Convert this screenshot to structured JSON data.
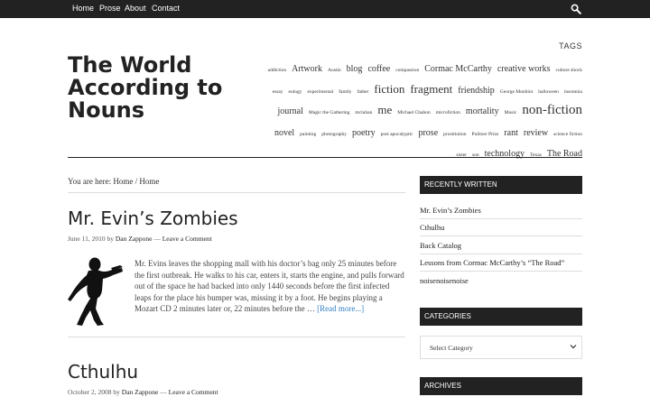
{
  "nav": {
    "items": [
      "Home",
      "Prose",
      "About",
      "Contact"
    ],
    "search_icon": "magnifier-icon"
  },
  "site": {
    "title": "The World According to Nouns"
  },
  "tags": {
    "heading": "TAGS",
    "cloud": [
      {
        "label": "addiction",
        "weight": 1
      },
      {
        "label": "Artwork",
        "weight": 3
      },
      {
        "label": "Austin",
        "weight": 1
      },
      {
        "label": "blog",
        "weight": 3
      },
      {
        "label": "coffee",
        "weight": 3
      },
      {
        "label": "compassion",
        "weight": 1
      },
      {
        "label": "Cormac McCarthy",
        "weight": 3
      },
      {
        "label": "creative works",
        "weight": 3
      },
      {
        "label": "culture shock",
        "weight": 1
      },
      {
        "label": "essay",
        "weight": 1
      },
      {
        "label": "eulogy",
        "weight": 1
      },
      {
        "label": "experimental",
        "weight": 1
      },
      {
        "label": "family",
        "weight": 1
      },
      {
        "label": "father",
        "weight": 1
      },
      {
        "label": "fiction",
        "weight": 4
      },
      {
        "label": "fragment",
        "weight": 4
      },
      {
        "label": "friendship",
        "weight": 3
      },
      {
        "label": "George Monbiot",
        "weight": 1
      },
      {
        "label": "halloween",
        "weight": 1
      },
      {
        "label": "insomnia",
        "weight": 1
      },
      {
        "label": "journal",
        "weight": 3
      },
      {
        "label": "Magic the Gathering",
        "weight": 1
      },
      {
        "label": "mcluhan",
        "weight": 1
      },
      {
        "label": "me",
        "weight": 4
      },
      {
        "label": "Michael Chabon",
        "weight": 1
      },
      {
        "label": "microfiction",
        "weight": 1
      },
      {
        "label": "mortality",
        "weight": 3
      },
      {
        "label": "Music",
        "weight": 1
      },
      {
        "label": "non-fiction",
        "weight": 5
      },
      {
        "label": "novel",
        "weight": 3
      },
      {
        "label": "painting",
        "weight": 1
      },
      {
        "label": "photography",
        "weight": 1
      },
      {
        "label": "poetry",
        "weight": 3
      },
      {
        "label": "post apocalyptic",
        "weight": 1
      },
      {
        "label": "prose",
        "weight": 3
      },
      {
        "label": "prostitution",
        "weight": 1
      },
      {
        "label": "Pulitzer Prize",
        "weight": 1
      },
      {
        "label": "rant",
        "weight": 3
      },
      {
        "label": "review",
        "weight": 3
      },
      {
        "label": "science fiction",
        "weight": 1
      },
      {
        "label": "sister",
        "weight": 1
      },
      {
        "label": "son",
        "weight": 1
      },
      {
        "label": "technology",
        "weight": 3
      },
      {
        "label": "Texas",
        "weight": 1
      },
      {
        "label": "The Road",
        "weight": 3
      }
    ]
  },
  "breadcrumb": {
    "prefix": "You are here:",
    "home": "Home",
    "separator": "/",
    "current": "Home"
  },
  "posts": [
    {
      "title": "Mr. Evin’s Zombies",
      "date": "June 11, 2010",
      "by": "by",
      "author": "Dan Zappone",
      "dash": "—",
      "comment_link": "Leave a Comment",
      "excerpt": "Mr. Evins leaves the shopping mall with his doctor’s bag only 25 minutes before the first outbreak. He walks to his car, enters it, starts the engine, and pulls forward out of the space he had backed into only 1440 seconds before the first infected leaps for the place his bumper was, missing it by a foot. He begins playing a Mozart CD 2 minutes later or, 22 minutes before the … ",
      "read_more": "[Read more...]",
      "image": "zombie-silhouette"
    },
    {
      "title": "Cthulhu",
      "date": "October 2, 2008",
      "by": "by",
      "author": "Dan Zappone",
      "dash": "—",
      "comment_link": "Leave a Comment"
    }
  ],
  "sidebar": {
    "recent": {
      "title": "RECENTLY WRITTEN",
      "items": [
        "Mr. Evin’s Zombies",
        "Cthulhu",
        "Back Catalog",
        "Lessons from Cormac McCarthy’s “The Road”",
        "noisenoisenoise"
      ]
    },
    "categories": {
      "title": "CATEGORIES",
      "select_value": "Select Category",
      "chevron_icon": "chevron-down-icon"
    },
    "archives": {
      "title": "ARCHIVES"
    }
  },
  "colors": {
    "nav_bg": "#222222",
    "widget_bg": "#222222",
    "link_blue": "#2f7dc7",
    "text": "#222222"
  }
}
